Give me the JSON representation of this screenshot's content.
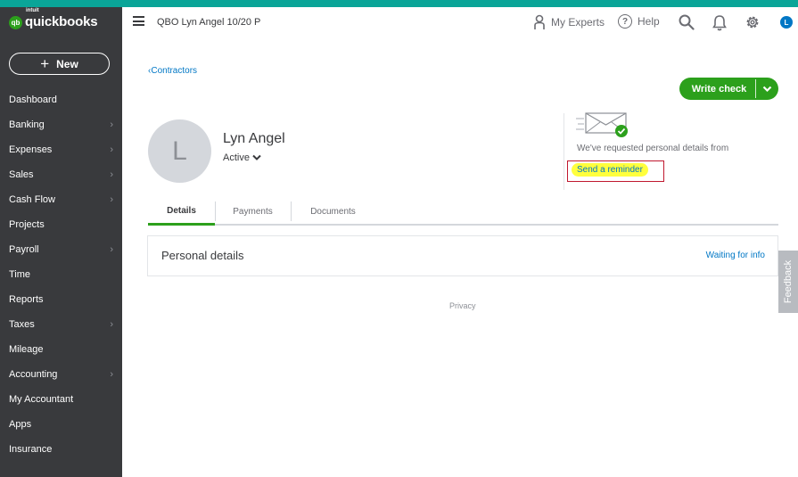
{
  "brand": {
    "small": "intuit",
    "name": "quickbooks",
    "mark": "qb"
  },
  "sidebar": {
    "new_label": "New",
    "items": [
      {
        "label": "Dashboard",
        "chevron": false
      },
      {
        "label": "Banking",
        "chevron": true
      },
      {
        "label": "Expenses",
        "chevron": true
      },
      {
        "label": "Sales",
        "chevron": true
      },
      {
        "label": "Cash Flow",
        "chevron": true
      },
      {
        "label": "Projects",
        "chevron": false
      },
      {
        "label": "Payroll",
        "chevron": true
      },
      {
        "label": "Time",
        "chevron": false
      },
      {
        "label": "Reports",
        "chevron": false
      },
      {
        "label": "Taxes",
        "chevron": true
      },
      {
        "label": "Mileage",
        "chevron": false
      },
      {
        "label": "Accounting",
        "chevron": true
      },
      {
        "label": "My Accountant",
        "chevron": false
      },
      {
        "label": "Apps",
        "chevron": false
      },
      {
        "label": "Insurance",
        "chevron": false
      }
    ]
  },
  "header": {
    "company": "QBO Lyn Angel 10/20 P",
    "my_experts": "My Experts",
    "help": "Help",
    "help_glyph": "?",
    "user_initial": "L"
  },
  "main": {
    "breadcrumb": "Contractors",
    "write_check": "Write check",
    "avatar_initial": "L",
    "name": "Lyn Angel",
    "status": "Active",
    "request_text": "We've requested personal details from",
    "reminder": "Send a reminder",
    "tabs": [
      "Details",
      "Payments",
      "Documents"
    ],
    "active_tab": "Details",
    "section_title": "Personal details",
    "section_link": "Waiting for info",
    "privacy": "Privacy",
    "feedback": "Feedback"
  },
  "colors": {
    "accent_green": "#2ca01c",
    "top_stripe": "#0aa598",
    "sidebar_bg": "#393a3d",
    "link_blue": "#0077c5",
    "highlight": "#ffff3d",
    "annotation_red": "#c0182f"
  },
  "icons": [
    "menu-icon",
    "person-icon",
    "help-icon",
    "search-icon",
    "bell-icon",
    "gear-icon",
    "envelope-check-icon",
    "chevron-down-icon",
    "chevron-left-icon",
    "chevron-right-icon",
    "plus-icon"
  ]
}
